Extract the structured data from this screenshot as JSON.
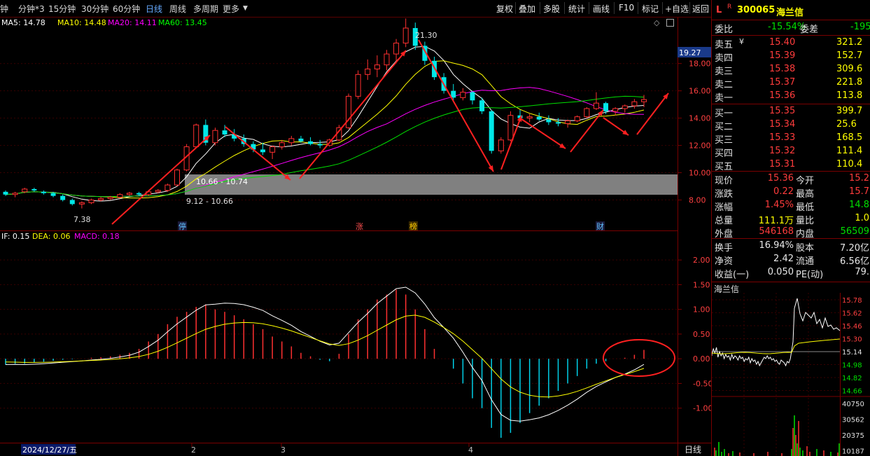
{
  "toolbar": {
    "periods": [
      "钟",
      "分钟*3",
      "15分钟",
      "30分钟",
      "60分钟",
      "日线",
      "周线",
      "多周期",
      "更多"
    ],
    "active_period": "日线",
    "tools": [
      "复权",
      "叠加",
      "多股",
      "统计",
      "画线",
      "F10",
      "标记",
      "+自选",
      "返回"
    ]
  },
  "ma_legend": [
    {
      "label": "MA5: 14.78",
      "color": "#ffffff"
    },
    {
      "label": "MA10: 14.48",
      "color": "#ffff00"
    },
    {
      "label": "MA20: 14.11",
      "color": "#ff00ff"
    },
    {
      "label": "MA60: 13.45",
      "color": "#00ff00"
    }
  ],
  "macd_legend": [
    {
      "label": "IF: 0.15",
      "color": "#ffffff"
    },
    {
      "label": "DEA: 0.06",
      "color": "#ffff00"
    },
    {
      "label": "MACD: 0.18",
      "color": "#ff00ff"
    }
  ],
  "price_axis": [
    "18.00",
    "16.00",
    "14.00",
    "12.00",
    "10.00",
    "8.00"
  ],
  "current_price_tag": "19.27",
  "macd_axis": [
    "2.00",
    "1.50",
    "1.00",
    "0.50",
    "0.00",
    "-0.50",
    "-1.00"
  ],
  "annotations": {
    "high": "21.30",
    "low": "7.38",
    "zone_label": "10.66 - 10.74",
    "zone_label2": "9.12 - 10.66"
  },
  "event_markers": [
    "停",
    "涨",
    "榜",
    "财"
  ],
  "x_labels": [
    "2024/12/27/五",
    "2",
    "3",
    "4"
  ],
  "right_axis_bottom": "日线",
  "stock": {
    "code": "300065",
    "name": "海兰信",
    "flag": "L",
    "r": "R"
  },
  "weibi": {
    "label": "委比",
    "value": "-15.54%",
    "label2": "委差",
    "value2": "-195"
  },
  "asks": [
    {
      "label": "卖五",
      "price": "15.40",
      "vol": "321.2"
    },
    {
      "label": "卖四",
      "price": "15.39",
      "vol": "152.7"
    },
    {
      "label": "卖三",
      "price": "15.38",
      "vol": "309.6"
    },
    {
      "label": "卖二",
      "price": "15.37",
      "vol": "221.8"
    },
    {
      "label": "卖一",
      "price": "15.36",
      "vol": "113.8"
    }
  ],
  "bids": [
    {
      "label": "买一",
      "price": "15.35",
      "vol": "399.7"
    },
    {
      "label": "买二",
      "price": "15.34",
      "vol": "25.6"
    },
    {
      "label": "买三",
      "price": "15.33",
      "vol": "168.5"
    },
    {
      "label": "买四",
      "price": "15.32",
      "vol": "111.4"
    },
    {
      "label": "买五",
      "price": "15.31",
      "vol": "110.4"
    }
  ],
  "quote": [
    {
      "l1": "现价",
      "v1": "15.36",
      "l2": "今开",
      "v2": "15.2"
    },
    {
      "l1": "涨跌",
      "v1": "0.22",
      "l2": "最高",
      "v2": "15.7"
    },
    {
      "l1": "涨幅",
      "v1": "1.45%",
      "l2": "最低",
      "v2": "14.8"
    },
    {
      "l1": "总量",
      "v1": "111.1万",
      "l2": "量比",
      "v2": "1.0"
    },
    {
      "l1": "外盘",
      "v1": "546168",
      "l2": "内盘",
      "v2": "56509"
    }
  ],
  "stats": [
    {
      "l1": "换手",
      "v1": "16.94%",
      "l2": "股本",
      "v2": "7.20亿"
    },
    {
      "l1": "净资",
      "v1": "2.42",
      "l2": "流通",
      "v2": "6.56亿"
    },
    {
      "l1": "收益(一)",
      "v1": "0.050",
      "l2": "PE(动)",
      "v2": "79."
    }
  ],
  "mini_chart": {
    "title": "海兰信",
    "price_axis": [
      "15.78",
      "15.62",
      "15.46",
      "15.30",
      "15.14",
      "14.98",
      "14.82",
      "14.66"
    ],
    "vol_axis": [
      "40750",
      "30562",
      "20375",
      "10187"
    ]
  },
  "chart_data": {
    "type": "candlestick",
    "candles": [
      [
        8.6,
        8.7,
        8.3,
        8.4
      ],
      [
        8.4,
        8.6,
        8.2,
        8.5
      ],
      [
        8.6,
        8.9,
        8.5,
        8.8
      ],
      [
        8.8,
        8.9,
        8.6,
        8.7
      ],
      [
        8.6,
        8.7,
        8.4,
        8.5
      ],
      [
        8.5,
        8.6,
        8.2,
        8.3
      ],
      [
        8.3,
        8.4,
        7.9,
        8.0
      ],
      [
        8.0,
        8.1,
        7.6,
        7.7
      ],
      [
        7.7,
        7.9,
        7.38,
        7.8
      ],
      [
        7.8,
        8.1,
        7.7,
        8.0
      ],
      [
        8.0,
        8.2,
        7.9,
        8.1
      ],
      [
        8.1,
        8.3,
        8.0,
        8.2
      ],
      [
        8.2,
        8.5,
        8.1,
        8.4
      ],
      [
        8.4,
        8.6,
        8.3,
        8.5
      ],
      [
        8.5,
        8.6,
        8.3,
        8.4
      ],
      [
        8.4,
        8.7,
        8.3,
        8.6
      ],
      [
        8.6,
        8.8,
        8.5,
        8.7
      ],
      [
        8.7,
        9.2,
        8.6,
        9.1
      ],
      [
        9.1,
        10.3,
        9.0,
        10.2
      ],
      [
        10.2,
        12.1,
        10.1,
        11.9
      ],
      [
        11.9,
        13.6,
        11.8,
        13.5
      ],
      [
        13.5,
        13.9,
        12.0,
        12.2
      ],
      [
        12.2,
        13.3,
        12.0,
        13.1
      ],
      [
        13.1,
        13.5,
        12.6,
        12.8
      ],
      [
        12.8,
        13.2,
        12.3,
        12.5
      ],
      [
        12.5,
        12.8,
        11.9,
        12.1
      ],
      [
        12.1,
        12.3,
        11.5,
        11.7
      ],
      [
        11.7,
        12.2,
        11.3,
        11.5
      ],
      [
        11.5,
        12.0,
        11.0,
        11.9
      ],
      [
        11.9,
        12.4,
        11.7,
        12.2
      ],
      [
        12.2,
        12.7,
        12.0,
        12.5
      ],
      [
        12.5,
        12.7,
        12.2,
        12.3
      ],
      [
        12.3,
        12.6,
        12.0,
        12.1
      ],
      [
        12.1,
        12.4,
        11.8,
        12.0
      ],
      [
        12.0,
        12.5,
        11.9,
        12.4
      ],
      [
        12.4,
        13.5,
        12.3,
        13.3
      ],
      [
        13.3,
        15.8,
        13.2,
        15.6
      ],
      [
        15.6,
        17.5,
        15.4,
        17.2
      ],
      [
        17.2,
        18.3,
        16.8,
        17.6
      ],
      [
        17.6,
        18.6,
        17.0,
        17.9
      ],
      [
        17.9,
        19.0,
        17.5,
        18.7
      ],
      [
        18.7,
        19.8,
        18.2,
        19.5
      ],
      [
        19.5,
        21.3,
        19.2,
        20.6
      ],
      [
        20.6,
        21.0,
        19.0,
        19.3
      ],
      [
        19.3,
        19.6,
        17.9,
        18.2
      ],
      [
        18.2,
        18.5,
        16.8,
        17.0
      ],
      [
        17.0,
        17.3,
        15.8,
        16.0
      ],
      [
        16.0,
        16.5,
        15.2,
        15.5
      ],
      [
        15.5,
        16.2,
        15.3,
        15.9
      ],
      [
        15.9,
        16.0,
        15.0,
        15.3
      ],
      [
        15.3,
        15.5,
        14.3,
        14.5
      ],
      [
        14.5,
        14.6,
        11.4,
        11.6
      ],
      [
        11.6,
        12.6,
        11.4,
        12.4
      ],
      [
        12.4,
        14.5,
        12.3,
        14.2
      ],
      [
        14.2,
        14.6,
        13.8,
        14.0
      ],
      [
        14.0,
        14.3,
        13.7,
        14.1
      ],
      [
        14.1,
        14.4,
        13.8,
        13.9
      ],
      [
        13.9,
        14.2,
        13.5,
        13.7
      ],
      [
        13.7,
        14.0,
        13.4,
        13.6
      ],
      [
        13.6,
        13.9,
        13.3,
        13.8
      ],
      [
        13.8,
        14.2,
        13.7,
        14.1
      ],
      [
        14.1,
        14.8,
        14.0,
        14.7
      ],
      [
        14.7,
        15.9,
        14.6,
        15.1
      ],
      [
        15.1,
        15.2,
        14.3,
        14.5
      ],
      [
        14.5,
        14.8,
        14.2,
        14.7
      ],
      [
        14.7,
        15.0,
        14.4,
        14.9
      ],
      [
        14.9,
        15.4,
        14.7,
        15.2
      ],
      [
        15.2,
        15.7,
        14.8,
        15.36
      ]
    ],
    "macd_histogram": [
      -0.12,
      -0.1,
      -0.1,
      -0.08,
      -0.06,
      -0.04,
      -0.02,
      -0.01,
      0,
      0.02,
      0.03,
      0.05,
      0.08,
      0.12,
      0.2,
      0.35,
      0.5,
      0.7,
      0.85,
      0.95,
      1.05,
      1.1,
      1.0,
      0.95,
      0.88,
      0.8,
      0.7,
      0.6,
      0.45,
      0.35,
      0.25,
      0.12,
      0.05,
      -0.02,
      -0.05,
      0.1,
      0.5,
      0.8,
      1.0,
      1.2,
      1.3,
      1.4,
      1.3,
      1.0,
      0.6,
      0.2,
      0,
      -0.2,
      -0.5,
      -0.8,
      -1.0,
      -1.4,
      -1.6,
      -1.5,
      -1.3,
      -1.1,
      -0.95,
      -0.8,
      -0.65,
      -0.5,
      -0.35,
      -0.2,
      -0.1,
      -0.05,
      0,
      0.02,
      0.08,
      0.18
    ],
    "ylim_price": [
      7,
      20.5
    ],
    "ylim_macd": [
      -1.6,
      2.3
    ]
  }
}
